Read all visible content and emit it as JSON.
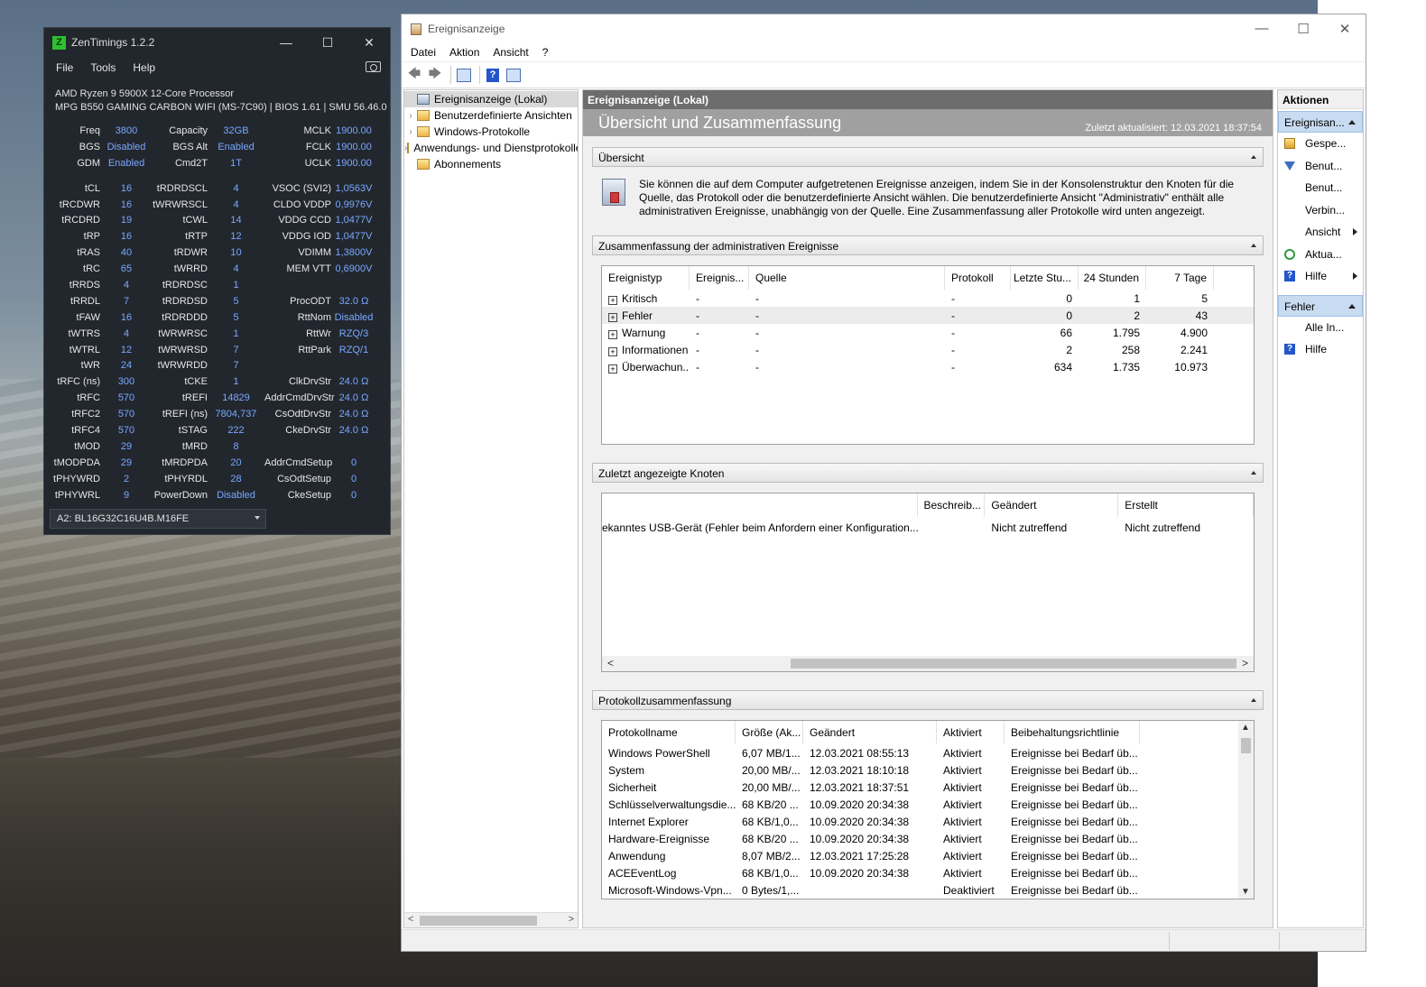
{
  "zentimings": {
    "title": "ZenTimings 1.2.2",
    "logo": "Z",
    "controls": [
      "—",
      "☐",
      "✕"
    ],
    "menu": [
      "File",
      "Tools",
      "Help"
    ],
    "cpu": "AMD Ryzen 9 5900X 12-Core Processor",
    "board": "MPG B550 GAMING CARBON WIFI (MS-7C90) | BIOS 1.61 | SMU 56.46.0",
    "rows_top": [
      [
        "Freq",
        "3800",
        "Capacity",
        "32GB",
        "MCLK",
        "1900.00"
      ],
      [
        "BGS",
        "Disabled",
        "BGS Alt",
        "Enabled",
        "FCLK",
        "1900.00"
      ],
      [
        "GDM",
        "Enabled",
        "Cmd2T",
        "1T",
        "UCLK",
        "1900.00"
      ]
    ],
    "rows_main": [
      [
        "tCL",
        "16",
        "tRDRDSCL",
        "4",
        "VSOC (SVI2)",
        "1,0563V"
      ],
      [
        "tRCDWR",
        "16",
        "tWRWRSCL",
        "4",
        "CLDO VDDP",
        "0,9976V"
      ],
      [
        "tRCDRD",
        "19",
        "tCWL",
        "14",
        "VDDG CCD",
        "1,0477V"
      ],
      [
        "tRP",
        "16",
        "tRTP",
        "12",
        "VDDG IOD",
        "1,0477V"
      ],
      [
        "tRAS",
        "40",
        "tRDWR",
        "10",
        "VDIMM",
        "1,3800V"
      ],
      [
        "tRC",
        "65",
        "tWRRD",
        "4",
        "MEM VTT",
        "0,6900V"
      ],
      [
        "tRRDS",
        "4",
        "tRDRDSC",
        "1",
        "",
        ""
      ],
      [
        "tRRDL",
        "7",
        "tRDRDSD",
        "5",
        "ProcODT",
        "32.0 Ω"
      ],
      [
        "tFAW",
        "16",
        "tRDRDDD",
        "5",
        "RttNom",
        "Disabled"
      ],
      [
        "tWTRS",
        "4",
        "tWRWRSC",
        "1",
        "RttWr",
        "RZQ/3"
      ],
      [
        "tWTRL",
        "12",
        "tWRWRSD",
        "7",
        "RttPark",
        "RZQ/1"
      ],
      [
        "tWR",
        "24",
        "tWRWRDD",
        "7",
        "",
        ""
      ],
      [
        "tRFC (ns)",
        "300",
        "tCKE",
        "1",
        "ClkDrvStr",
        "24.0 Ω"
      ],
      [
        "tRFC",
        "570",
        "tREFI",
        "14829",
        "AddrCmdDrvStr",
        "24.0 Ω"
      ],
      [
        "tRFC2",
        "570",
        "tREFI (ns)",
        "7804,737",
        "CsOdtDrvStr",
        "24.0 Ω"
      ],
      [
        "tRFC4",
        "570",
        "tSTAG",
        "222",
        "CkeDrvStr",
        "24.0 Ω"
      ],
      [
        "tMOD",
        "29",
        "tMRD",
        "8",
        "",
        ""
      ],
      [
        "tMODPDA",
        "29",
        "tMRDPDA",
        "20",
        "AddrCmdSetup",
        "0"
      ],
      [
        "tPHYWRD",
        "2",
        "tPHYRDL",
        "28",
        "CsOdtSetup",
        "0"
      ],
      [
        "tPHYWRL",
        "9",
        "PowerDown",
        "Disabled",
        "CkeSetup",
        "0"
      ]
    ],
    "dimm": "A2: BL16G32C16U4B.M16FE",
    "value_color": "#7aa8ff"
  },
  "eventviewer": {
    "title": "Ereignisanzeige",
    "controls": [
      "—",
      "☐",
      "✕"
    ],
    "menu": [
      "Datei",
      "Aktion",
      "Ansicht",
      "?"
    ],
    "toolbar": {
      "back": "🡄",
      "forward": "🡆",
      "help": "?"
    },
    "tree": [
      {
        "label": "Ereignisanzeige (Lokal)",
        "arrow": "",
        "selected": true
      },
      {
        "label": "Benutzerdefinierte Ansichten",
        "arrow": "›",
        "selected": false
      },
      {
        "label": "Windows-Protokolle",
        "arrow": "›",
        "selected": false
      },
      {
        "label": "Anwendungs- und Dienstprotokolle",
        "arrow": "›",
        "selected": false
      },
      {
        "label": "Abonnements",
        "arrow": "",
        "selected": false
      }
    ],
    "tree_scroll": {
      "left": "<",
      "right": ">"
    },
    "center_header": "Ereignisanzeige (Lokal)",
    "band_title": "Übersicht und Zusammenfassung",
    "last_updated": "Zuletzt aktualisiert: 12.03.2021 18:37:54",
    "overview": {
      "title": "Übersicht",
      "text": "Sie können die auf dem Computer aufgetretenen Ereignisse anzeigen, indem Sie in der Konsolenstruktur den Knoten für die Quelle, das Protokoll oder die benutzerdefinierte Ansicht wählen. Die benutzerdefinierte Ansicht \"Administrativ\" enthält alle administrativen Ereignisse, unabhängig von der Quelle. Eine Zusammenfassung aller Protokolle wird unten angezeigt."
    },
    "admin_summary": {
      "title": "Zusammenfassung der administrativen Ereignisse",
      "columns": [
        "Ereignistyp",
        "Ereignis...",
        "Quelle",
        "Protokoll",
        "Letzte Stu...",
        "24 Stunden",
        "7 Tage"
      ],
      "rows": [
        [
          "Kritisch",
          "-",
          "-",
          "-",
          "0",
          "1",
          "5"
        ],
        [
          "Fehler",
          "-",
          "-",
          "-",
          "0",
          "2",
          "43"
        ],
        [
          "Warnung",
          "-",
          "-",
          "-",
          "66",
          "1.795",
          "4.900"
        ],
        [
          "Informationen",
          "-",
          "-",
          "-",
          "2",
          "258",
          "2.241"
        ],
        [
          "Überwachun...",
          "-",
          "-",
          "-",
          "634",
          "1.735",
          "10.973"
        ]
      ]
    },
    "recent_nodes": {
      "title": "Zuletzt angezeigte Knoten",
      "columns": [
        "",
        "Beschreib...",
        "Geändert",
        "Erstellt"
      ],
      "rows": [
        [
          "ekanntes USB-Gerät (Fehler beim Anfordern einer Konfiguration...",
          "",
          "Nicht zutreffend",
          "Nicht zutreffend"
        ]
      ],
      "scroll": {
        "left": "<",
        "right": ">"
      }
    },
    "log_summary": {
      "title": "Protokollzusammenfassung",
      "columns": [
        "Protokollname",
        "Größe (Ak...",
        "Geändert",
        "Aktiviert",
        "Beibehaltungsrichtlinie"
      ],
      "rows": [
        [
          "Windows PowerShell",
          "6,07 MB/1...",
          "12.03.2021 08:55:13",
          "Aktiviert",
          "Ereignisse bei Bedarf üb..."
        ],
        [
          "System",
          "20,00 MB/...",
          "12.03.2021 18:10:18",
          "Aktiviert",
          "Ereignisse bei Bedarf üb..."
        ],
        [
          "Sicherheit",
          "20,00 MB/...",
          "12.03.2021 18:37:51",
          "Aktiviert",
          "Ereignisse bei Bedarf üb..."
        ],
        [
          "Schlüsselverwaltungsdie...",
          "68 KB/20 ...",
          "10.09.2020 20:34:38",
          "Aktiviert",
          "Ereignisse bei Bedarf üb..."
        ],
        [
          "Internet Explorer",
          "68 KB/1,0...",
          "10.09.2020 20:34:38",
          "Aktiviert",
          "Ereignisse bei Bedarf üb..."
        ],
        [
          "Hardware-Ereignisse",
          "68 KB/20 ...",
          "10.09.2020 20:34:38",
          "Aktiviert",
          "Ereignisse bei Bedarf üb..."
        ],
        [
          "Anwendung",
          "8,07 MB/2...",
          "12.03.2021 17:25:28",
          "Aktiviert",
          "Ereignisse bei Bedarf üb..."
        ],
        [
          "ACEEventLog",
          "68 KB/1,0...",
          "10.09.2020 20:34:38",
          "Aktiviert",
          "Ereignisse bei Bedarf üb..."
        ],
        [
          "Microsoft-Windows-Vpn...",
          "0 Bytes/1,...",
          "",
          "Deaktiviert",
          "Ereignisse bei Bedarf üb..."
        ]
      ],
      "scroll": {
        "up": "▲",
        "down": "▼"
      }
    },
    "actions": {
      "title": "Aktionen",
      "section1": "Ereignisan...",
      "section1_items": [
        {
          "label": "Gespe...",
          "icon": "folder-icon",
          "submenu": false
        },
        {
          "label": "Benut...",
          "icon": "filter-icon",
          "submenu": false
        },
        {
          "label": "Benut...",
          "icon": "",
          "submenu": false
        },
        {
          "label": "Verbin...",
          "icon": "",
          "submenu": false
        },
        {
          "label": "Ansicht",
          "icon": "",
          "submenu": true
        },
        {
          "label": "Aktua...",
          "icon": "refresh-icon",
          "submenu": false
        },
        {
          "label": "Hilfe",
          "icon": "help-icon",
          "submenu": true
        }
      ],
      "section2": "Fehler",
      "section2_items": [
        {
          "label": "Alle In...",
          "icon": "",
          "submenu": false
        },
        {
          "label": "Hilfe",
          "icon": "help-icon",
          "submenu": false
        }
      ]
    }
  }
}
